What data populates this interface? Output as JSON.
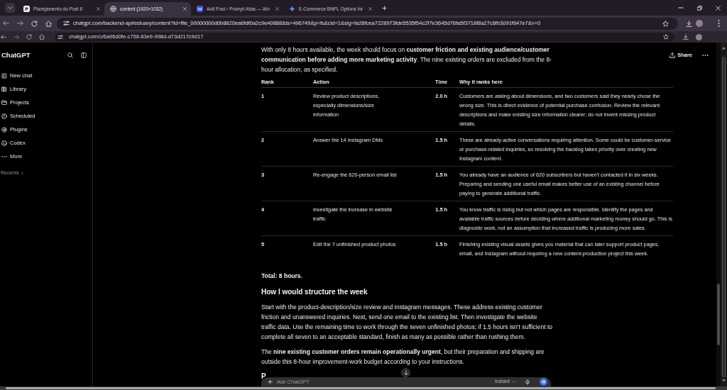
{
  "browser": {
    "tabs": [
      {
        "title": "Planejamento do Post 6",
        "selected": false
      },
      {
        "title": "content (1920×1032)",
        "selected": true
      },
      {
        "title": "Add Post ‹ Prompt Atlas — Wo",
        "selected": false
      },
      {
        "title": "E-Commerce BNPL Options for",
        "selected": false
      }
    ],
    "address": "chatgpt.com/backend-api/estuary/content?id=file_00000000d0b8820ea6fdf0a2c9e40888&ts=496749&p=fs&cid=1&sig=fa28fcea7228973fde5535f54c2f7e3645d76fa5f3718f8a27c6fb3091f647e7&v=0"
  },
  "inner_browser": {
    "address": "chatgpt.com/c/6a96d0fe-c758-83e9-998d-d73d217c9d17"
  },
  "sidebar": {
    "title": "ChatGPT",
    "items": [
      {
        "label": "New chat"
      },
      {
        "label": "Library"
      },
      {
        "label": "Projects"
      },
      {
        "label": "Scheduled"
      },
      {
        "label": "Plugins"
      },
      {
        "label": "Codex"
      },
      {
        "label": "More"
      }
    ],
    "recents": "Recents"
  },
  "header": {
    "share": "Share"
  },
  "message": {
    "intro": "With only 8 hours available, the week should focus on **customer friction and existing audience/customer communication before adding more marketing activity**. The nine existing orders are excluded from the 8-hour allocation, as specified.",
    "table": {
      "columns": [
        "Rank",
        "Action",
        "Time",
        "Why it ranks here"
      ],
      "rows": [
        [
          "1",
          "Review product descriptions, especially dimensions/size information",
          "2.0 h",
          "Customers are asking about dimensions, and two customers said they nearly chose the wrong size. This is direct evidence of potential purchase confusion. Review the relevant descriptions and make existing size information clearer; do not invent missing product details."
        ],
        [
          "2",
          "Answer the 14 Instagram DMs",
          "1.5 h",
          "These are already-active conversations requiring attention. Some could be customer-service or purchase-related inquiries, so resolving the backlog takes priority over creating new Instagram content."
        ],
        [
          "3",
          "Re-engage the 620-person email list",
          "1.5 h",
          "You already have an audience of 620 subscribers but haven't contacted it in six weeks. Preparing and sending one useful email makes better use of an existing channel before paying to generate additional traffic."
        ],
        [
          "4",
          "Investigate the increase in website traffic",
          "1.5 h",
          "You know traffic is rising but not which pages are responsible. Identify the pages and available traffic sources before deciding where additional marketing money should go. This is diagnostic work, not an assumption that increased traffic is producing more sales."
        ],
        [
          "5",
          "Edit the 7 unfinished product photos",
          "1.5 h",
          "Finishing existing visual assets gives you material that can later support product pages, email, and Instagram without requiring a new content-production project this week."
        ]
      ]
    },
    "total": "Total: 8 hours.",
    "heading": "How I would structure the week",
    "paragraphs": [
      "Start with the product-description/size review and Instagram messages. These address existing customer friction and unanswered inquiries. Next, send one email to the existing list. Then investigate the website traffic data. Use the remaining time to work through the seven unfinished photos; if 1.5 hours isn't sufficient to complete all seven to an acceptable standard, finish as many as possible rather than rushing them.",
      "The **nine existing customer orders remain operationally urgent**, but their preparation and shipping are outside this 8-hour improvement-work budget according to your instructions."
    ],
    "next_heading": "P"
  },
  "composer": {
    "placeholder": "Ask ChatGPT",
    "mode": "Instant"
  }
}
